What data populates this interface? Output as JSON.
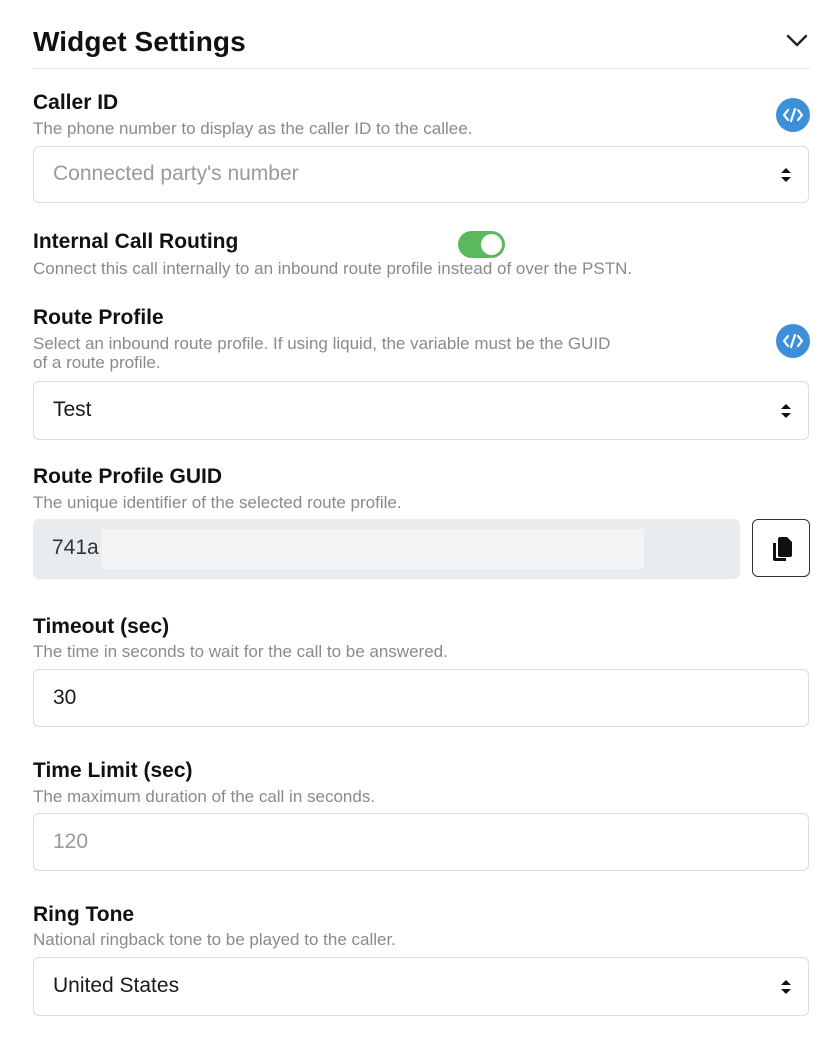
{
  "header": {
    "title": "Widget Settings",
    "collapse_icon": "chevron-down-icon"
  },
  "caller_id": {
    "label": "Caller ID",
    "description": "The phone number to display as the caller ID to the callee.",
    "placeholder": "Connected party's number",
    "liquid_icon": "code-icon"
  },
  "internal_routing": {
    "label": "Internal Call Routing",
    "description": "Connect this call internally to an inbound route profile instead of over the PSTN.",
    "enabled": true
  },
  "route_profile": {
    "label": "Route Profile",
    "description_line1": "Select an inbound route profile. If using liquid, the variable must be the GUID",
    "description_line2": "of a route profile.",
    "value": "Test",
    "liquid_icon": "code-icon"
  },
  "route_guid": {
    "label": "Route Profile GUID",
    "description": "The unique identifier of the selected route profile.",
    "value": "741a",
    "copy_icon": "copy-icon"
  },
  "timeout": {
    "label": "Timeout (sec)",
    "description": "The time in seconds to wait for the call to be answered.",
    "value": "30"
  },
  "time_limit": {
    "label": "Time Limit (sec)",
    "description": "The maximum duration of the call in seconds.",
    "placeholder": "120"
  },
  "ring_tone": {
    "label": "Ring Tone",
    "description": "National ringback tone to be played to the caller.",
    "value": "United States"
  },
  "colors": {
    "accent_blue": "#3d8fd9",
    "toggle_green": "#5cb85c",
    "readonly_bg": "#e9ecee"
  }
}
